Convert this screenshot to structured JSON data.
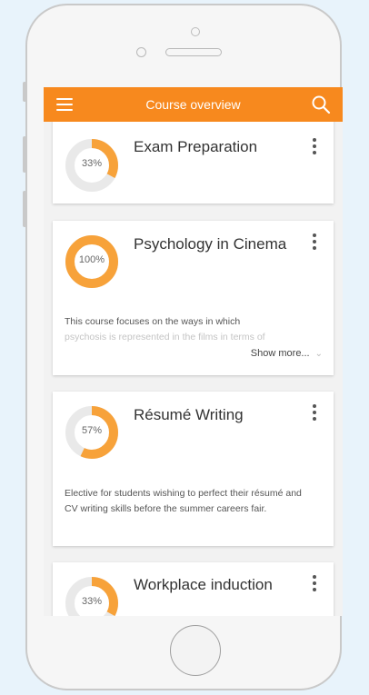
{
  "appbar": {
    "title": "Course overview",
    "menu_icon": "hamburger-menu-icon",
    "search_icon": "search-icon",
    "color": "#f7891e"
  },
  "courses": [
    {
      "title": "Exam Preparation",
      "progress_label": "33%",
      "progress": 0.33,
      "description": "",
      "show_more": ""
    },
    {
      "title": "Psychology in Cinema",
      "progress_label": "100%",
      "progress": 1.0,
      "description_line1": "This course focuses on the ways in which",
      "description_line2": "psychosis is represented in the films in terms of",
      "show_more": "Show more..."
    },
    {
      "title": "Résumé Writing",
      "progress_label": "57%",
      "progress": 0.57,
      "description": "Elective for students wishing to perfect their résumé and CV writing skills before the summer careers fair."
    },
    {
      "title": "Workplace induction",
      "progress_label": "33%",
      "progress": 0.33
    }
  ],
  "colors": {
    "accent": "#f7891e",
    "ring_track": "#e9e9e9",
    "ring_fill": "#f7a23a"
  }
}
